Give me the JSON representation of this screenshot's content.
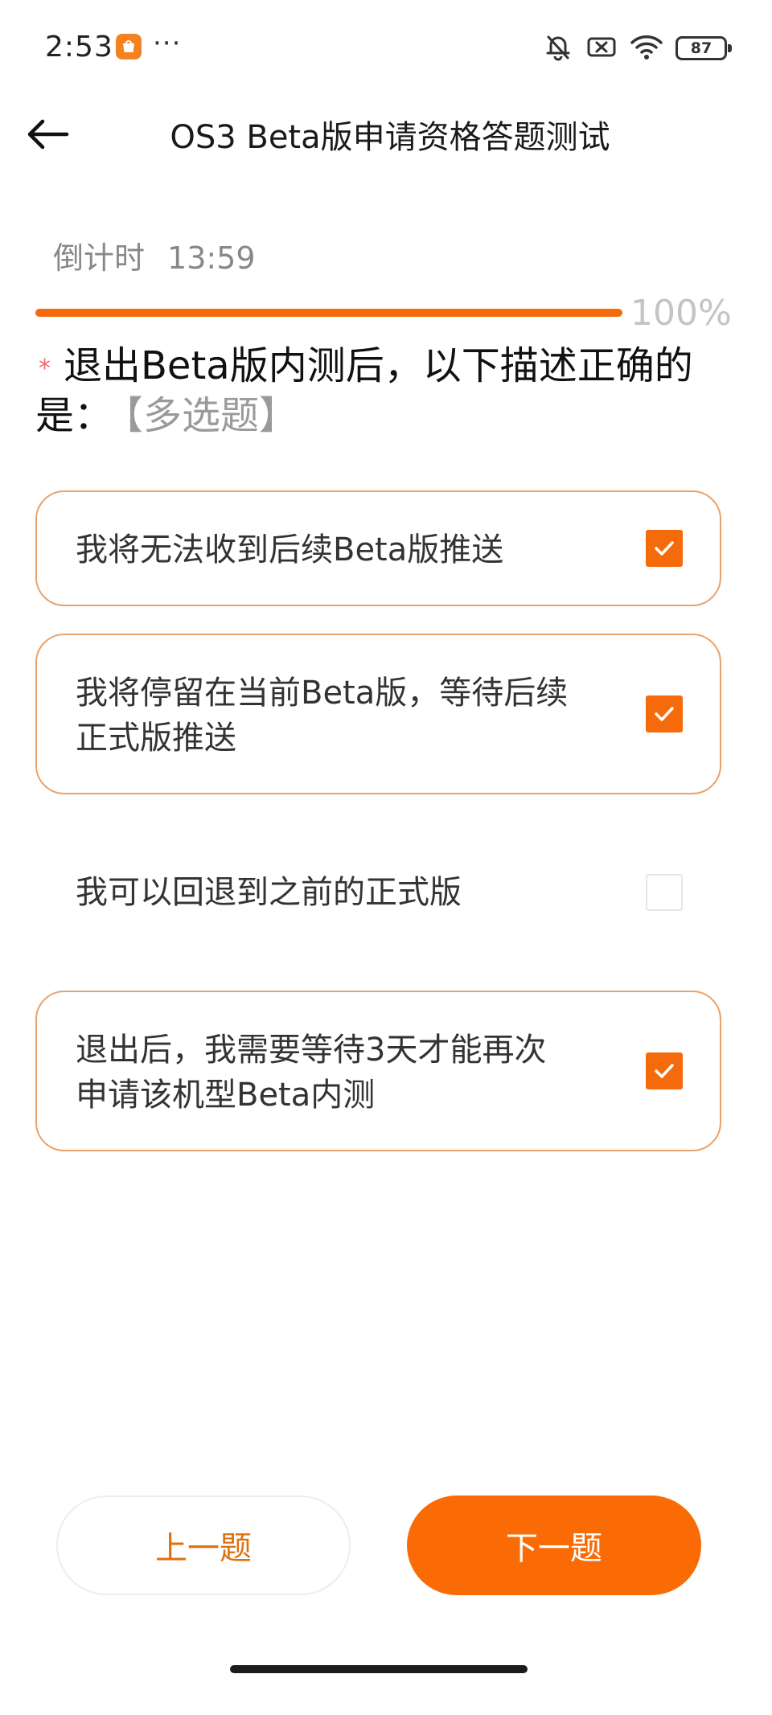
{
  "status_bar": {
    "time": "2:53",
    "more": "···",
    "battery": "87",
    "icons": [
      "mute-bell-icon",
      "screen-record-icon",
      "wifi-icon",
      "battery-icon"
    ],
    "accent": "#f58220"
  },
  "header": {
    "title": "OS3 Beta版申请资格答题测试"
  },
  "countdown": {
    "label": "倒计时",
    "time": "13:59"
  },
  "progress": {
    "percent_text": "100%",
    "value": 1.0,
    "color": "#f56a0a"
  },
  "question": {
    "required_mark": "*",
    "text": "退出Beta版内测后，以下描述正确的是：",
    "type": "【多选题】"
  },
  "options": [
    {
      "text": "我将无法收到后续Beta版推送",
      "checked": true
    },
    {
      "text": "我将停留在当前Beta版，等待后续正式版推送",
      "checked": true
    },
    {
      "text": "我可以回退到之前的正式版",
      "checked": false
    },
    {
      "text": "退出后，我需要等待3天才能再次申请该机型Beta内测",
      "checked": true
    }
  ],
  "buttons": {
    "prev": "上一题",
    "next": "下一题"
  }
}
